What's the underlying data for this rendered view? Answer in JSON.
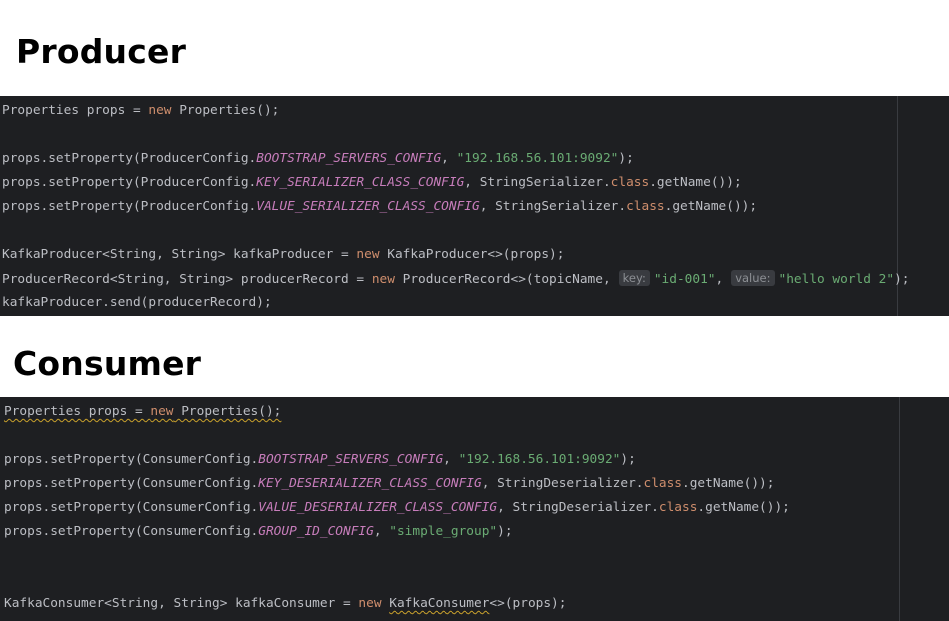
{
  "producer": {
    "heading": "Producer",
    "lines": [
      {
        "row": 0,
        "segments": [
          {
            "t": "Properties props = ",
            "c": "plain"
          },
          {
            "t": "new",
            "c": "kw"
          },
          {
            "t": " Properties();",
            "c": "plain"
          }
        ]
      },
      {
        "row": 2,
        "segments": [
          {
            "t": "props.setProperty(ProducerConfig.",
            "c": "plain"
          },
          {
            "t": "BOOTSTRAP_SERVERS_CONFIG",
            "c": "fld"
          },
          {
            "t": ", ",
            "c": "plain"
          },
          {
            "t": "\"192.168.56.101:9092\"",
            "c": "str"
          },
          {
            "t": ");",
            "c": "plain"
          }
        ]
      },
      {
        "row": 3,
        "segments": [
          {
            "t": "props.setProperty(ProducerConfig.",
            "c": "plain"
          },
          {
            "t": "KEY_SERIALIZER_CLASS_CONFIG",
            "c": "fld"
          },
          {
            "t": ", StringSerializer.",
            "c": "plain"
          },
          {
            "t": "class",
            "c": "kw"
          },
          {
            "t": ".getName());",
            "c": "plain"
          }
        ]
      },
      {
        "row": 4,
        "segments": [
          {
            "t": "props.setProperty(ProducerConfig.",
            "c": "plain"
          },
          {
            "t": "VALUE_SERIALIZER_CLASS_CONFIG",
            "c": "fld"
          },
          {
            "t": ", StringSerializer.",
            "c": "plain"
          },
          {
            "t": "class",
            "c": "kw"
          },
          {
            "t": ".getName());",
            "c": "plain"
          }
        ]
      },
      {
        "row": 6,
        "segments": [
          {
            "t": "KafkaProducer<String, String> kafkaProducer = ",
            "c": "plain"
          },
          {
            "t": "new",
            "c": "kw"
          },
          {
            "t": " KafkaProducer<>(props);",
            "c": "plain"
          }
        ]
      },
      {
        "row": 7,
        "segments": [
          {
            "t": "ProducerRecord<String, String> producerRecord = ",
            "c": "plain"
          },
          {
            "t": "new",
            "c": "kw"
          },
          {
            "t": " ProducerRecord<>(topicName,",
            "c": "plain"
          },
          {
            "t": "key:",
            "c": "hint"
          },
          {
            "t": "\"id-001\"",
            "c": "str"
          },
          {
            "t": ",",
            "c": "plain"
          },
          {
            "t": "value:",
            "c": "hint"
          },
          {
            "t": "\"hello world 2\"",
            "c": "str"
          },
          {
            "t": ");",
            "c": "plain"
          }
        ]
      },
      {
        "row": 8,
        "segments": [
          {
            "t": "kafkaProducer.send(producerRecord);",
            "c": "plain"
          }
        ]
      }
    ]
  },
  "consumer": {
    "heading": "Consumer",
    "lines": [
      {
        "row": 0,
        "segments": [
          {
            "t": "Properties props = ",
            "c": "plain warn"
          },
          {
            "t": "new",
            "c": "kw warn"
          },
          {
            "t": " Properties();",
            "c": "plain warn"
          }
        ]
      },
      {
        "row": 2,
        "segments": [
          {
            "t": "props.setProperty(ConsumerConfig.",
            "c": "plain"
          },
          {
            "t": "BOOTSTRAP_SERVERS_CONFIG",
            "c": "fld"
          },
          {
            "t": ", ",
            "c": "plain"
          },
          {
            "t": "\"192.168.56.101:9092\"",
            "c": "str"
          },
          {
            "t": ");",
            "c": "plain"
          }
        ]
      },
      {
        "row": 3,
        "segments": [
          {
            "t": "props.setProperty(ConsumerConfig.",
            "c": "plain"
          },
          {
            "t": "KEY_DESERIALIZER_CLASS_CONFIG",
            "c": "fld"
          },
          {
            "t": ", StringDeserializer.",
            "c": "plain"
          },
          {
            "t": "class",
            "c": "kw"
          },
          {
            "t": ".getName());",
            "c": "plain"
          }
        ]
      },
      {
        "row": 4,
        "segments": [
          {
            "t": "props.setProperty(ConsumerConfig.",
            "c": "plain"
          },
          {
            "t": "VALUE_DESERIALIZER_CLASS_CONFIG",
            "c": "fld"
          },
          {
            "t": ", StringDeserializer.",
            "c": "plain"
          },
          {
            "t": "class",
            "c": "kw"
          },
          {
            "t": ".getName());",
            "c": "plain"
          }
        ]
      },
      {
        "row": 5,
        "segments": [
          {
            "t": "props.setProperty(ConsumerConfig.",
            "c": "plain"
          },
          {
            "t": "GROUP_ID_CONFIG",
            "c": "fld"
          },
          {
            "t": ", ",
            "c": "plain"
          },
          {
            "t": "\"simple_group\"",
            "c": "str"
          },
          {
            "t": ");",
            "c": "plain"
          }
        ]
      },
      {
        "row": 8,
        "segments": [
          {
            "t": "KafkaConsumer<String, String> kafkaConsumer = ",
            "c": "plain"
          },
          {
            "t": "new",
            "c": "kw"
          },
          {
            "t": " ",
            "c": "plain"
          },
          {
            "t": "KafkaConsumer",
            "c": "plain warn"
          },
          {
            "t": "<>(props);",
            "c": "plain"
          }
        ]
      }
    ]
  },
  "theme": {
    "editor_background": "#1e1f22",
    "text": "#bcbec4",
    "keyword": "#cf8e6d",
    "constant_field": "#c77dbb",
    "string": "#6aab73",
    "inlay_hint_background": "#393b40",
    "inlay_hint_text": "#8c8f94"
  }
}
